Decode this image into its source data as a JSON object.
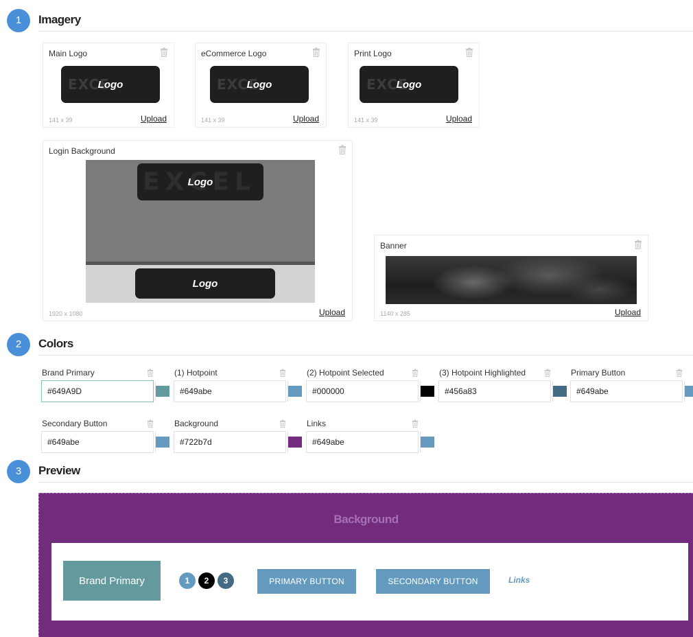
{
  "sections": {
    "imagery": {
      "number": "1",
      "title": "Imagery"
    },
    "colors": {
      "number": "2",
      "title": "Colors"
    },
    "preview": {
      "number": "3",
      "title": "Preview"
    }
  },
  "imagery": {
    "logo_text": "Logo",
    "ghost_small": "EXCE",
    "ghost_big": "EXCEL",
    "upload_label": "Upload",
    "main_logo": {
      "label": "Main Logo",
      "dims": "141 x 39"
    },
    "ecommerce_logo": {
      "label": "eCommerce Logo",
      "dims": "141 x 39"
    },
    "print_logo": {
      "label": "Print Logo",
      "dims": "141 x 39"
    },
    "login_background": {
      "label": "Login Background",
      "dims": "1920 x 1080"
    },
    "banner": {
      "label": "Banner",
      "dims": "1140 x 285"
    }
  },
  "colors": {
    "brand_primary": {
      "label": "Brand Primary",
      "value": "#649A9D",
      "swatch": "#649a9d"
    },
    "hotpoint": {
      "label": "(1) Hotpoint",
      "value": "#649abe",
      "swatch": "#649abe"
    },
    "hotpoint_selected": {
      "label": "(2) Hotpoint Selected",
      "value": "#000000",
      "swatch": "#000000"
    },
    "hotpoint_highlighted": {
      "label": "(3) Hotpoint Highlighted",
      "value": "#456a83",
      "swatch": "#456a83"
    },
    "primary_button": {
      "label": "Primary Button",
      "value": "#649abe",
      "swatch": "#649abe"
    },
    "secondary_button": {
      "label": "Secondary Button",
      "value": "#649abe",
      "swatch": "#649abe"
    },
    "background": {
      "label": "Background",
      "value": "#722b7d",
      "swatch": "#722b7d"
    },
    "links": {
      "label": "Links",
      "value": "#649abe",
      "swatch": "#649abe"
    }
  },
  "preview": {
    "background_label": "Background",
    "brand_primary_label": "Brand Primary",
    "hotpoints": [
      "1",
      "2",
      "3"
    ],
    "primary_button_label": "PRIMARY BUTTON",
    "secondary_button_label": "SECONDARY BUTTON",
    "links_label": "Links"
  }
}
